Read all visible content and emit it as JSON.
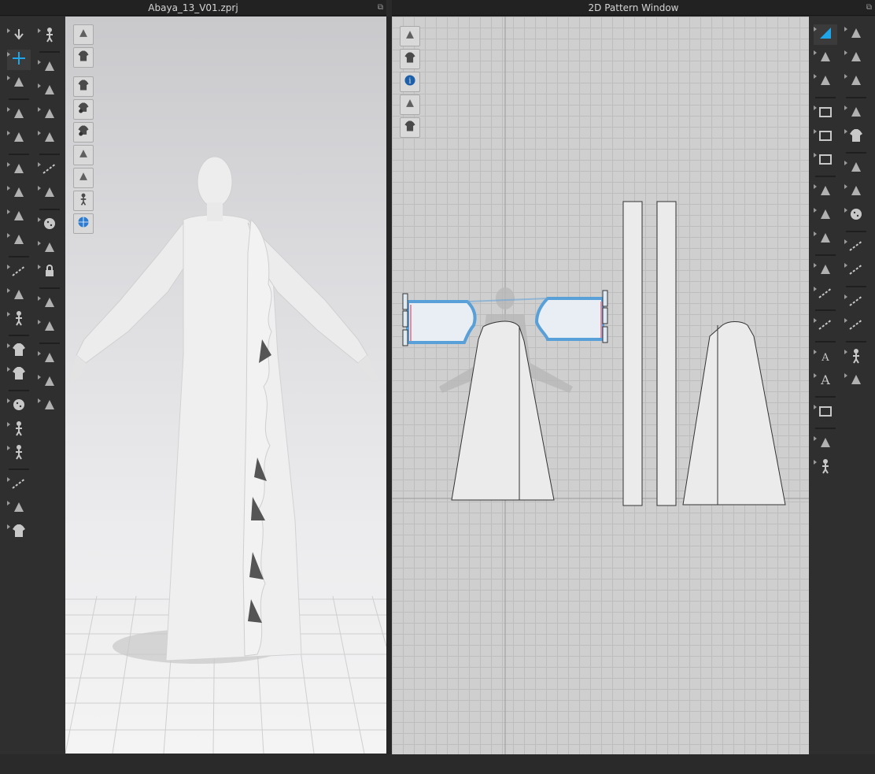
{
  "left_window": {
    "title": "Abaya_13_V01.zprj"
  },
  "right_window": {
    "title": "2D Pattern Window"
  },
  "colors": {
    "accent": "#1ea6e8",
    "toolbar_bg": "#2f2f2f",
    "viewport_bg": "#e4e4e6",
    "pattern_bg": "#cfcfcf",
    "selection": "#5aa0d8"
  },
  "left_toolbar_col1": [
    "arrow-down-icon",
    "transform-pattern-icon",
    "lasso-select-icon",
    "simulation-icon",
    "fold-icon",
    "point-select-icon",
    "tack-icon",
    "pin-icon",
    "needle-icon",
    "measure-icon",
    "puckering-icon",
    "avatar-measure-icon",
    "shirt-icon",
    "garment-icon",
    "button-icon",
    "avatar-icon",
    "pose-icon",
    "tape-icon",
    "hanger-icon",
    "garment-fit-icon"
  ],
  "left_toolbar_col2": [
    "walk-icon",
    "brush-erase-icon",
    "brush-strengthen-icon",
    "brush-smooth-icon",
    "shrink-icon",
    "stitch-icon",
    "texture-icon",
    "button-round-icon",
    "zipper-icon",
    "lock-icon",
    "zip-slider-icon",
    "fabric-icon",
    "swatch-icon",
    "vertical-flip-icon",
    "arrows-in-icon"
  ],
  "viewport3d_tools": [
    "box-icon",
    "shirt-toggle-icon",
    "eye-garment-icon",
    "eye-pattern-icon",
    "eye-avatar-icon",
    "texture-toggle-icon",
    "shading-icon",
    "avatar-head-icon",
    "globe-icon"
  ],
  "pattern_tools": [
    "pencil-icon",
    "eye-shirt-icon",
    "info-icon",
    "layers-icon",
    "lock-shirt-icon"
  ],
  "right_toolbar_col1": [
    "edit-pattern-icon",
    "polygon-icon",
    "internal-shape-icon",
    "rectangle-icon",
    "folder-icon",
    "dash-rect-icon",
    "shield-icon",
    "cut-icon",
    "notch-icon",
    "trim-icon",
    "ruler-icon",
    "tape-measure-icon",
    "text-a-icon",
    "text-a-large-icon",
    "grid-icon",
    "fold-pattern-icon",
    "avatar-small-icon"
  ],
  "right_toolbar_col2": [
    "segment-edit-icon",
    "seam-edit-icon",
    "link-icon",
    "iron-icon",
    "shirt-plain-icon",
    "flatten-icon",
    "texture-pattern-icon",
    "check-fabric-icon",
    "dashed-line-icon",
    "topstitch-icon",
    "zigzag-stitch-icon",
    "wave-stitch-icon",
    "add-avatar-icon",
    "rack-icon"
  ]
}
